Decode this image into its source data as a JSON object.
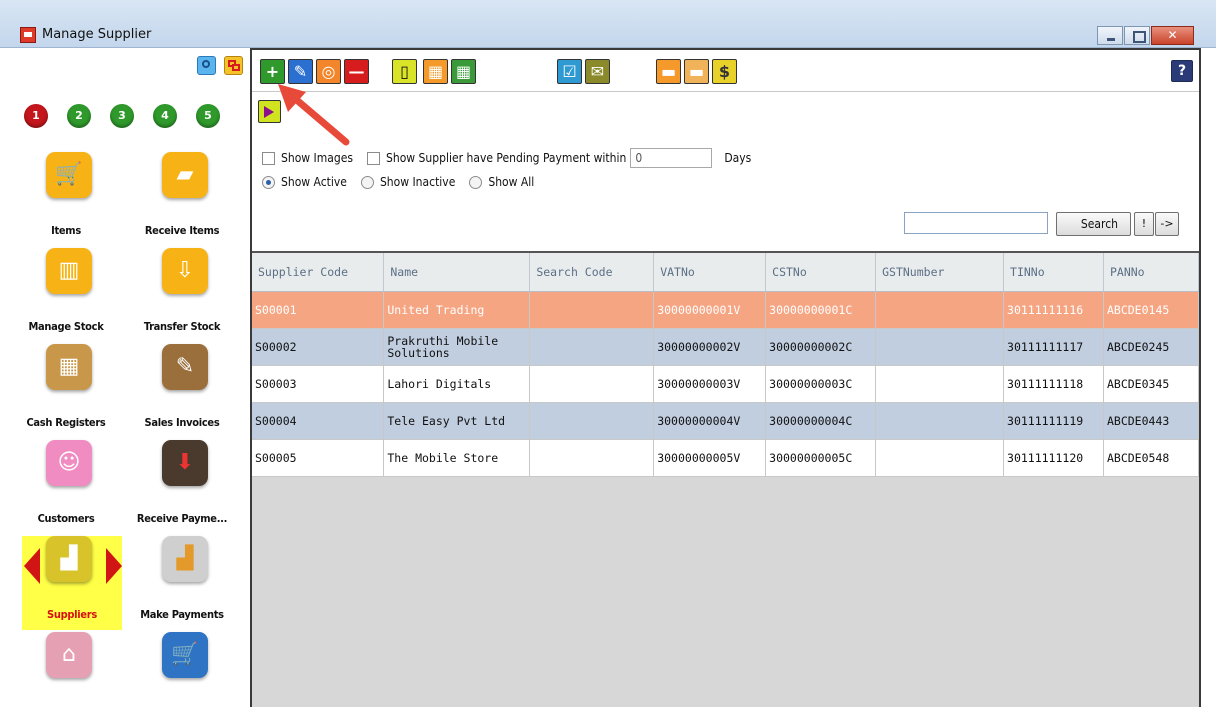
{
  "window": {
    "title": "Manage Supplier",
    "close_glyph": "✕",
    "icon": "app-cart-icon"
  },
  "sidebar": {
    "top_icons": [
      "search-icon",
      "windows-icon"
    ],
    "steps": [
      "1",
      "2",
      "3",
      "4",
      "5"
    ],
    "items": [
      {
        "label": "Items",
        "icon": "cart-icon",
        "color": "#f7b315"
      },
      {
        "label": "Receive Items",
        "icon": "truck-icon",
        "color": "#f7b315"
      },
      {
        "label": "Manage Stock",
        "icon": "stock-icon",
        "color": "#f7b315"
      },
      {
        "label": "Transfer Stock",
        "icon": "transfer-icon",
        "color": "#f7b315"
      },
      {
        "label": "Cash Registers",
        "icon": "register-icon",
        "color": "#c99749"
      },
      {
        "label": "Sales Invoices",
        "icon": "invoice-icon",
        "color": "#9a6f3c"
      },
      {
        "label": "Customers",
        "icon": "customers-icon",
        "color": "#f08cc2"
      },
      {
        "label": "Receive Payme...",
        "icon": "receive-payment-icon",
        "color": "#4a3a2e"
      },
      {
        "label": "Suppliers",
        "icon": "factory-icon",
        "color": "#d8c42a"
      },
      {
        "label": "Make Payments",
        "icon": "make-payment-icon",
        "color": "#cfcfcf"
      },
      {
        "label": "",
        "icon": "store-icon",
        "color": "#e6a0b4"
      },
      {
        "label": "",
        "icon": "cart-remove-icon",
        "color": "#2f74c4"
      }
    ]
  },
  "toolbar": {
    "help_label": "?",
    "buttons": [
      {
        "name": "add-button",
        "glyph": "+",
        "color": "#2f9a2b"
      },
      {
        "name": "edit-button",
        "glyph": "✎",
        "color": "#2b6fd1"
      },
      {
        "name": "view-button",
        "glyph": "◎",
        "color": "#f3862b"
      },
      {
        "name": "delete-button",
        "glyph": "—",
        "color": "#d61c1c"
      },
      {
        "name": "new-doc-button",
        "glyph": "▯",
        "color": "#d9e327"
      },
      {
        "name": "grid-button",
        "glyph": "▦",
        "color": "#f39a2a"
      },
      {
        "name": "grid-down-button",
        "glyph": "▦",
        "color": "#3a9a3a"
      },
      {
        "name": "checklist-button",
        "glyph": "☑",
        "color": "#2f9ad1"
      },
      {
        "name": "email-button",
        "glyph": "✉",
        "color": "#8a8a2a"
      },
      {
        "name": "truck-button",
        "glyph": "▬",
        "color": "#f59a2a"
      },
      {
        "name": "truck-alt-button",
        "glyph": "▬",
        "color": "#f0b35a"
      },
      {
        "name": "factory-money-button",
        "glyph": "$",
        "color": "#e8d22a"
      }
    ]
  },
  "filters": {
    "show_images": "Show Images",
    "pending_label": "Show Supplier have Pending Payment within",
    "pending_days_value": "0",
    "days_label": "Days",
    "show_active": "Show Active",
    "show_inactive": "Show Inactive",
    "show_all": "Show All"
  },
  "search": {
    "value": "",
    "button_label": "Search",
    "bang_label": "!",
    "next_label": "->"
  },
  "table": {
    "columns": [
      "Supplier Code",
      "Name",
      "Search Code",
      "VATNo",
      "CSTNo",
      "GSTNumber",
      "TINNo",
      "PANNo"
    ],
    "rows": [
      [
        "S00001",
        "United Trading",
        "",
        "30000000001V",
        "30000000001C",
        "",
        "30111111116",
        "ABCDE0145"
      ],
      [
        "S00002",
        "Prakruthi Mobile Solutions",
        "",
        "30000000002V",
        "30000000002C",
        "",
        "30111111117",
        "ABCDE0245"
      ],
      [
        "S00003",
        "Lahori Digitals",
        "",
        "30000000003V",
        "30000000003C",
        "",
        "30111111118",
        "ABCDE0345"
      ],
      [
        "S00004",
        "Tele Easy Pvt Ltd",
        "",
        "30000000004V",
        "30000000004C",
        "",
        "30111111119",
        "ABCDE0443"
      ],
      [
        "S00005",
        "The Mobile Store",
        "",
        "30000000005V",
        "30000000005C",
        "",
        "30111111120",
        "ABCDE0548"
      ]
    ]
  },
  "colors": {
    "selected_row": "#f6a583",
    "alt_row": "#c1cee0",
    "callout_arrow": "#e84a3a"
  }
}
